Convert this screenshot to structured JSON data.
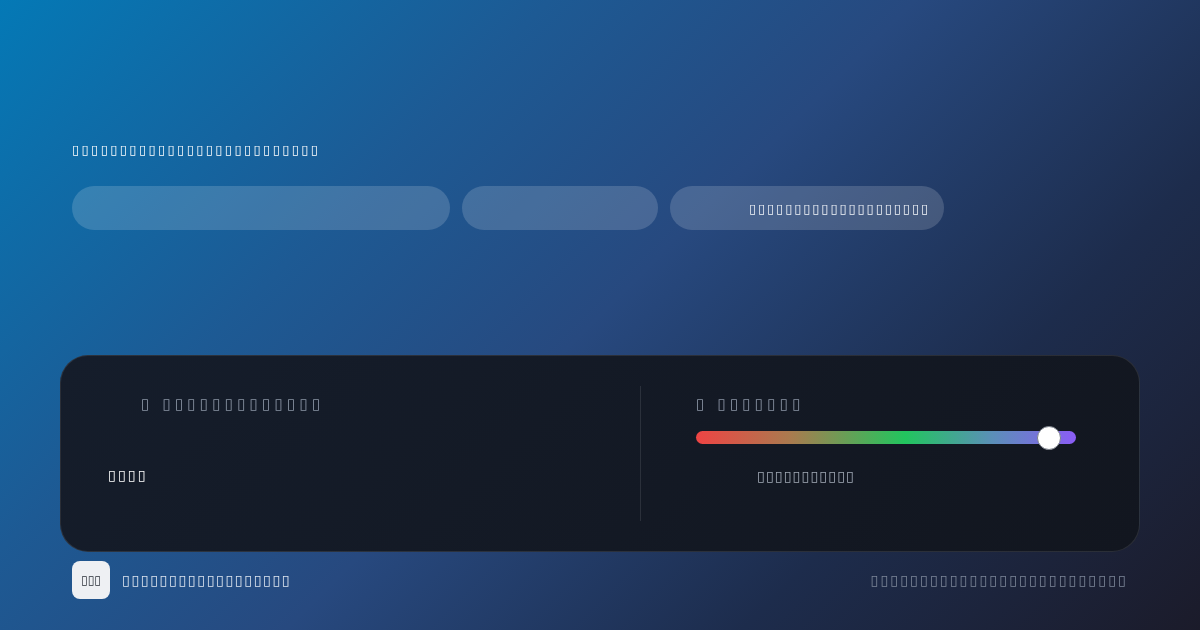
{
  "heading": "▯▯▯▯▯▯▯▯▯▯▯▯▯▯▯▯▯▯▯▯▯▯▯▯▯▯",
  "fields": [
    {
      "kind": "blank"
    },
    {
      "kind": "blank"
    },
    {
      "kind": "text",
      "text": "▯▯▯▯▯▯▯▯▯▯▯▯▯▯▯▯▯▯▯▯"
    }
  ],
  "panel": {
    "left": {
      "label": "▯ ▯▯▯▯▯▯▯▯▯▯▯▯▯",
      "value": "▯▯▯▯"
    },
    "right": {
      "label": "▯ ▯▯▯▯▯▯▯",
      "slider": {
        "level": 0.93
      },
      "caption": "▯▯▯▯▯▯▯▯▯▯▯"
    }
  },
  "footer": {
    "logo": "▯▯▯",
    "title": "▯▯▯▯▯▯▯▯▯▯▯▯▯▯▯▯▯▯",
    "note": "▯▯▯▯▯▯▯▯▯▯▯▯▯▯▯▯▯▯▯▯▯▯▯▯▯▯"
  }
}
